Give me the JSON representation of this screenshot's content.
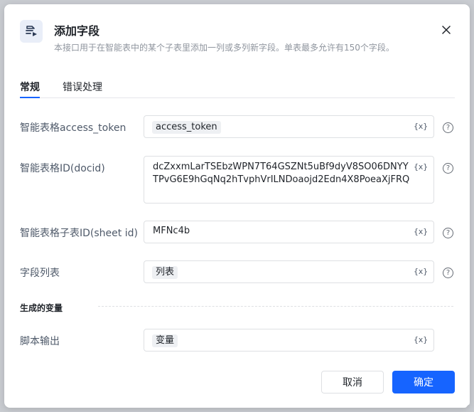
{
  "dialog": {
    "title": "添加字段",
    "subtitle": "本接口用于在智能表中的某个子表里添加一列或多列新字段。单表最多允许有150个字段。"
  },
  "tabs": [
    {
      "label": "常规",
      "active": true
    },
    {
      "label": "错误处理",
      "active": false
    }
  ],
  "fields": {
    "access_token": {
      "label": "智能表格access_token",
      "value": "access_token"
    },
    "docid": {
      "label": "智能表格ID(docid)",
      "value": "dcZxxmLarTSEbzWPN7T64GSZNt5uBf9dyV8SO06DNYYTPvG6E9hGqNq2hTvphVrILNDoaojd2Edn4X8PoeaXjFRQ"
    },
    "sheet_id": {
      "label": "智能表格子表ID(sheet id)",
      "value": "MFNc4b"
    },
    "field_list": {
      "label": "字段列表",
      "value": "列表"
    }
  },
  "section": {
    "generated_variables": "生成的变量"
  },
  "output": {
    "label": "脚本输出",
    "value": "变量"
  },
  "var_button": "{x}",
  "help_symbol": "?",
  "buttons": {
    "cancel": "取消",
    "confirm": "确定"
  },
  "colors": {
    "primary": "#1664ff",
    "text": "#1f2329",
    "muted": "#8f959e"
  }
}
